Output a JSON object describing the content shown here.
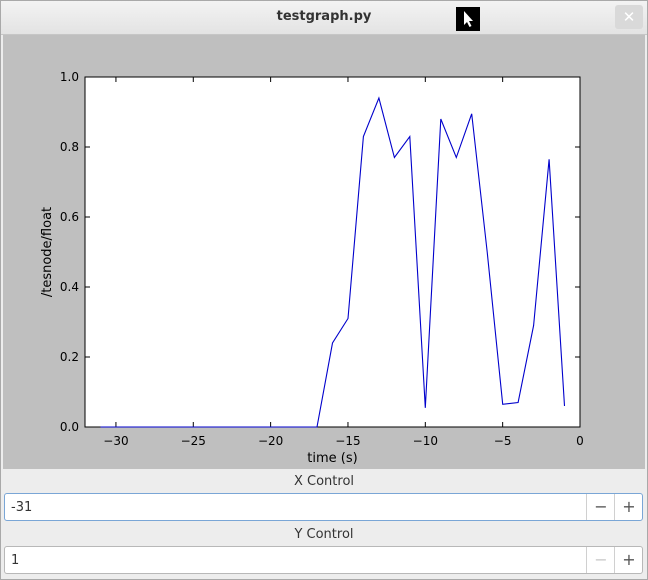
{
  "window": {
    "title": "testgraph.py"
  },
  "icons": {
    "cursor": "pointer-arrow-icon",
    "close": "close-icon",
    "minus": "minus-icon",
    "plus": "plus-icon"
  },
  "chart_data": {
    "type": "line",
    "xlabel": "time (s)",
    "ylabel": "/tesnode/float",
    "xlim": [
      -32,
      0
    ],
    "ylim": [
      0.0,
      1.0
    ],
    "xticks": [
      -30,
      -25,
      -20,
      -15,
      -10,
      -5,
      0
    ],
    "yticks": [
      0.0,
      0.2,
      0.4,
      0.6,
      0.8,
      1.0
    ],
    "ytick_labels": [
      "0.0",
      "0.2",
      "0.4",
      "0.6",
      "0.8",
      "1.0"
    ],
    "color": "#0000cc",
    "x": [
      -31,
      -30,
      -29,
      -28,
      -27,
      -26,
      -25,
      -24,
      -23,
      -22,
      -21,
      -20,
      -19,
      -18,
      -17,
      -16,
      -15,
      -14,
      -13,
      -12,
      -11,
      -10,
      -9,
      -8,
      -7,
      -6,
      -5,
      -4,
      -3,
      -2,
      -1
    ],
    "y": [
      0,
      0,
      0,
      0,
      0,
      0,
      0,
      0,
      0,
      0,
      0,
      0,
      0,
      0,
      0,
      0.24,
      0.31,
      0.83,
      0.94,
      0.77,
      0.83,
      0.055,
      0.88,
      0.77,
      0.895,
      0.5,
      0.065,
      0.07,
      0.29,
      0.765,
      0.06
    ]
  },
  "x_control": {
    "label": "X Control",
    "value": "-31",
    "minus": "−",
    "plus": "+"
  },
  "y_control": {
    "label": "Y Control",
    "value": "1",
    "minus": "−",
    "plus": "+"
  }
}
